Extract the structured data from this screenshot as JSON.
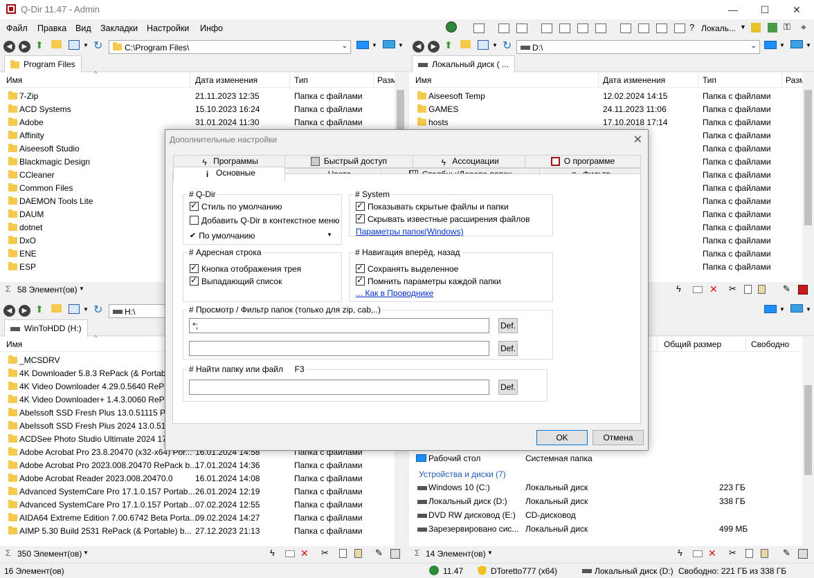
{
  "window": {
    "title": "Q-Dir 11.47 - Admin",
    "minimize": "—",
    "maximize": "☐",
    "close": "✕"
  },
  "menu": [
    "Файл",
    "Правка",
    "Вид",
    "Закладки",
    "Настройки",
    "Инфо"
  ],
  "toolbar": {
    "locale_label": "Локаль..."
  },
  "columns": {
    "name": "Имя",
    "date": "Дата изменения",
    "type": "Тип",
    "size": "Разм",
    "total": "Общий размер",
    "free": "Свободно"
  },
  "pane_tl": {
    "address": "C:\\Program Files\\",
    "tab": "Program Files",
    "rows": [
      {
        "name": "7-Zip",
        "date": "21.11.2023 12:35",
        "type": "Папка с файлами"
      },
      {
        "name": "ACD Systems",
        "date": "15.10.2023 16:24",
        "type": "Папка с файлами"
      },
      {
        "name": "Adobe",
        "date": "31.01.2024 11:30",
        "type": "Папка с файлами"
      },
      {
        "name": "Affinity",
        "date": "",
        "type": ""
      },
      {
        "name": "Aiseesoft Studio",
        "date": "",
        "type": ""
      },
      {
        "name": "Blackmagic Design",
        "date": "",
        "type": ""
      },
      {
        "name": "CCleaner",
        "date": "",
        "type": ""
      },
      {
        "name": "Common Files",
        "date": "",
        "type": ""
      },
      {
        "name": "DAEMON Tools Lite",
        "date": "",
        "type": ""
      },
      {
        "name": "DAUM",
        "date": "",
        "type": ""
      },
      {
        "name": "dotnet",
        "date": "",
        "type": ""
      },
      {
        "name": "DxO",
        "date": "",
        "type": ""
      },
      {
        "name": "ENE",
        "date": "",
        "type": ""
      },
      {
        "name": "ESP",
        "date": "",
        "type": ""
      }
    ],
    "status": "58 Элемент(ов)"
  },
  "pane_tr": {
    "address": "D:\\",
    "tab": "Локальный диск ( ...",
    "rows": [
      {
        "name": "Aiseesoft Temp",
        "date": "12.02.2024 14:15",
        "type": "Папка с файлами"
      },
      {
        "name": "GAMES",
        "date": "24.11.2023 11:06",
        "type": "Папка с файлами"
      },
      {
        "name": "hosts",
        "date": "17.10.2018 17:14",
        "type": "Папка с файлами"
      },
      {
        "name": "",
        "date": "0:17",
        "type": "Папка с файлами"
      },
      {
        "name": "",
        "date": "1:53",
        "type": "Папка с файлами"
      },
      {
        "name": "",
        "date": "2:38",
        "type": "Папка с файлами"
      },
      {
        "name": "",
        "date": "1:29",
        "type": "Папка с файлами"
      },
      {
        "name": "",
        "date": "3:24",
        "type": "Папка с файлами"
      },
      {
        "name": "",
        "date": "0:30",
        "type": "Папка с файлами"
      },
      {
        "name": "",
        "date": "4:08",
        "type": "Папка с файлами"
      },
      {
        "name": "",
        "date": "0:18",
        "type": "Папка с файлами"
      },
      {
        "name": "",
        "date": "0:48",
        "type": "Папка с файлами"
      },
      {
        "name": "",
        "date": "5:45",
        "type": "Папка с файлами"
      },
      {
        "name": "",
        "date": "1:58",
        "type": "Папка с файлами"
      }
    ]
  },
  "pane_bl": {
    "address": "H:\\",
    "tab": "WinToHDD (H:)",
    "rows": [
      {
        "name": "_MCSDRV",
        "date": "",
        "type": ""
      },
      {
        "name": "4K Downloader 5.8.3 RePack (& Portable",
        "date": "",
        "type": ""
      },
      {
        "name": "4K Video Downloader 4.29.0.5640 RePack",
        "date": "",
        "type": ""
      },
      {
        "name": "4K Video Downloader+ 1.4.3.0060 RePack",
        "date": "",
        "type": ""
      },
      {
        "name": "Abelssoft SSD Fresh Plus 13.0.51115 Porta",
        "date": "",
        "type": ""
      },
      {
        "name": "Abelssoft SSD Fresh Plus 2024 13.0.51115",
        "date": "",
        "type": ""
      },
      {
        "name": "ACDSee Photo Studio Ultimate 2024 17.0",
        "date": "",
        "type": ""
      },
      {
        "name": "Adobe Acrobat Pro 23.8.20470 (x32-x64) Por...",
        "date": "16.01.2024 14:58",
        "type": "Папка с файлами"
      },
      {
        "name": "Adobe Acrobat Pro 2023.008.20470 RePack b...",
        "date": "17.01.2024 14:36",
        "type": "Папка с файлами"
      },
      {
        "name": "Adobe Acrobat Reader 2023.008.20470.0",
        "date": "16.01.2024 14:08",
        "type": "Папка с файлами"
      },
      {
        "name": "Advanced SystemCare Pro 17.1.0.157 Portab...",
        "date": "26.01.2024 12:19",
        "type": "Папка с файлами"
      },
      {
        "name": "Advanced SystemCare Pro 17.1.0.157 Portab...",
        "date": "07.02.2024 12:55",
        "type": "Папка с файлами"
      },
      {
        "name": "AIDA64 Extreme Edition 7.00.6742 Beta Porta...",
        "date": "09.02.2024 14:27",
        "type": "Папка с файлами"
      },
      {
        "name": "AIMP 5.30 Build 2531 RePack (& Portable) b...",
        "date": "27.12.2023 21:13",
        "type": "Папка с файлами"
      }
    ],
    "status": "350 Элемент(ов)"
  },
  "pane_br": {
    "desktop": {
      "name": "Рабочий стол",
      "type": "Системная папка"
    },
    "group": "Устройства и диски (7)",
    "drives": [
      {
        "name": "Windows 10 (C:)",
        "type": "Локальный диск",
        "total": "223 ГБ"
      },
      {
        "name": "Локальный диск (D:)",
        "type": "Локальный диск",
        "total": "338 ГБ"
      },
      {
        "name": "DVD RW дисковод (E:)",
        "type": "CD-дисковод",
        "total": ""
      },
      {
        "name": "Зарезервировано сис...",
        "type": "Локальный диск",
        "total": "499 МБ"
      }
    ],
    "status": "14 Элемент(ов)"
  },
  "statusbar": {
    "items": "16 Элемент(ов)",
    "version": "11.47",
    "user": "DToretto777 (x64)",
    "drive": "Локальный диск (D:)",
    "free": "Свободно: 221 ГБ из 338 ГБ"
  },
  "dialog": {
    "title": "Дополнительные настройки",
    "tabs_row1": [
      "Программы",
      "Быстрый доступ",
      "Ассоциации",
      "О программе"
    ],
    "tabs_row2": [
      "Основные",
      "Цвета",
      "Столбцы/Дерево папок",
      "Фильтр"
    ],
    "qdir": {
      "legend": "# Q-Dir",
      "style_default": "Стиль по умолчанию",
      "context_menu": "Добавить Q-Dir в контекстное меню",
      "dropdown": "По умолчанию"
    },
    "system": {
      "legend": "# System",
      "show_hidden": "Показывать скрытые файлы и папки",
      "hide_ext": "Скрывать известные расширения файлов",
      "link": "Параметры папок(Windows)"
    },
    "address": {
      "legend": "# Адресная строка",
      "tray_btn": "Кнопка отображения трея",
      "dropdown_list": "Выпадающий список"
    },
    "nav": {
      "legend": "# Навигация вперёд, назад",
      "keep_sel": "Сохранять выделенное",
      "remember": "Помнить параметры каждой папки",
      "link": "... Как в Проводнике"
    },
    "filter": {
      "legend": "# Просмотр / Фильтр папок (только для zip, cab,..)",
      "value1": "*;",
      "value2": "",
      "def": "Def."
    },
    "find": {
      "legend": "# Найти папку или файл     F3",
      "value": "",
      "def": "Def."
    },
    "ok": "OK",
    "cancel": "Отмена"
  }
}
